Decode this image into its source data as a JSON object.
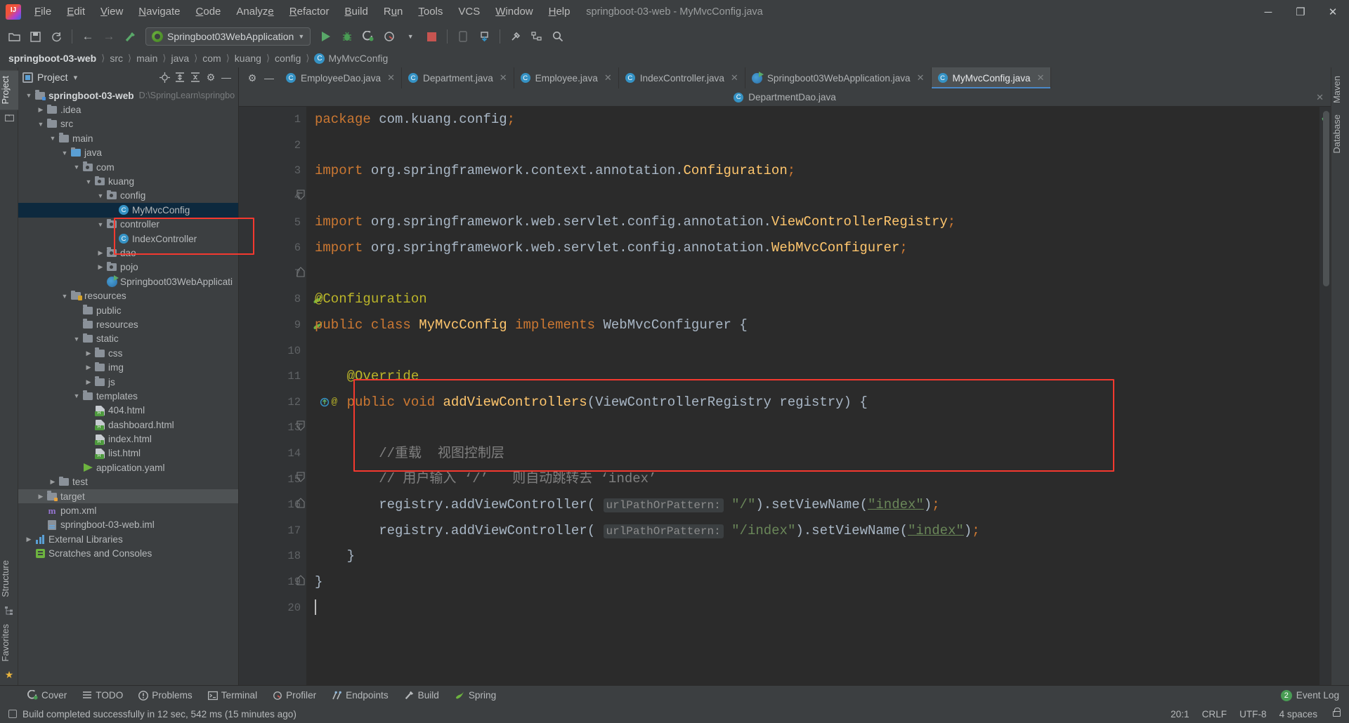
{
  "window": {
    "title": "springboot-03-web - MyMvcConfig.java",
    "minimize": "─",
    "maximize": "❐",
    "close": "✕"
  },
  "menu": {
    "items": [
      "File",
      "Edit",
      "View",
      "Navigate",
      "Code",
      "Analyze",
      "Refactor",
      "Build",
      "Run",
      "Tools",
      "VCS",
      "Window",
      "Help"
    ]
  },
  "toolbar": {
    "open_icon": "open-folder-icon",
    "save_icon": "save-icon",
    "sync_icon": "sync-icon",
    "back_icon": "←",
    "forward_icon": "→",
    "build_icon": "hammer-icon",
    "run_config": "Springboot03WebApplication",
    "run_icon": "run-icon",
    "debug_icon": "debug-icon",
    "coverage_icon": "run-with-coverage-icon",
    "profile_icon": "profile-icon",
    "stop_icon": "stop-icon",
    "device_icon": "device-manager-icon",
    "update_icon": "update-project-icon",
    "settings_icon": "settings-icon",
    "search_icon": "search-everywhere-icon"
  },
  "breadcrumb": {
    "items": [
      "springboot-03-web",
      "src",
      "main",
      "java",
      "com",
      "kuang",
      "config",
      "MyMvcConfig"
    ],
    "last_is_class": true
  },
  "left_rail": {
    "top": [
      "Project"
    ],
    "bottom": [
      "Structure",
      "Favorites"
    ]
  },
  "right_rail": {
    "items": [
      "Maven",
      "Database"
    ]
  },
  "project_panel": {
    "title": "Project",
    "dropdown": "▾",
    "locate_icon": "locate-icon",
    "expand_icon": "expand-all-icon",
    "collapse_icon": "collapse-all-icon",
    "settings_icon": "gear-icon",
    "hide_icon": "hide-icon",
    "tree": [
      {
        "label": "springboot-03-web",
        "path": "D:\\SpringLearn\\springbo",
        "depth": 0,
        "arrow": "down",
        "icon": "module-folder",
        "bold": true
      },
      {
        "label": ".idea",
        "depth": 1,
        "arrow": "right",
        "icon": "folder"
      },
      {
        "label": "src",
        "depth": 1,
        "arrow": "down",
        "icon": "folder"
      },
      {
        "label": "main",
        "depth": 2,
        "arrow": "down",
        "icon": "folder"
      },
      {
        "label": "java",
        "depth": 3,
        "arrow": "down",
        "icon": "source-folder"
      },
      {
        "label": "com",
        "depth": 4,
        "arrow": "down",
        "icon": "package"
      },
      {
        "label": "kuang",
        "depth": 5,
        "arrow": "down",
        "icon": "package"
      },
      {
        "label": "config",
        "depth": 6,
        "arrow": "down",
        "icon": "package"
      },
      {
        "label": "MyMvcConfig",
        "depth": 7,
        "arrow": "none",
        "icon": "class",
        "selected": true
      },
      {
        "label": "controller",
        "depth": 6,
        "arrow": "down",
        "icon": "package"
      },
      {
        "label": "IndexController",
        "depth": 7,
        "arrow": "none",
        "icon": "class"
      },
      {
        "label": "dao",
        "depth": 6,
        "arrow": "right",
        "icon": "package"
      },
      {
        "label": "pojo",
        "depth": 6,
        "arrow": "right",
        "icon": "package"
      },
      {
        "label": "Springboot03WebApplicati",
        "depth": 6,
        "arrow": "none",
        "icon": "spring-run-class"
      },
      {
        "label": "resources",
        "depth": 3,
        "arrow": "down",
        "icon": "resource-folder"
      },
      {
        "label": "public",
        "depth": 4,
        "arrow": "none",
        "icon": "folder"
      },
      {
        "label": "resources",
        "depth": 4,
        "arrow": "none",
        "icon": "folder"
      },
      {
        "label": "static",
        "depth": 4,
        "arrow": "down",
        "icon": "folder"
      },
      {
        "label": "css",
        "depth": 5,
        "arrow": "right",
        "icon": "folder"
      },
      {
        "label": "img",
        "depth": 5,
        "arrow": "right",
        "icon": "folder"
      },
      {
        "label": "js",
        "depth": 5,
        "arrow": "right",
        "icon": "folder"
      },
      {
        "label": "templates",
        "depth": 4,
        "arrow": "down",
        "icon": "folder"
      },
      {
        "label": "404.html",
        "depth": 5,
        "arrow": "none",
        "icon": "html"
      },
      {
        "label": "dashboard.html",
        "depth": 5,
        "arrow": "none",
        "icon": "html"
      },
      {
        "label": "index.html",
        "depth": 5,
        "arrow": "none",
        "icon": "html"
      },
      {
        "label": "list.html",
        "depth": 5,
        "arrow": "none",
        "icon": "html"
      },
      {
        "label": "application.yaml",
        "depth": 4,
        "arrow": "none",
        "icon": "yaml"
      },
      {
        "label": "test",
        "depth": 2,
        "arrow": "right",
        "icon": "folder"
      },
      {
        "label": "target",
        "depth": 1,
        "arrow": "right",
        "icon": "target-folder",
        "hover": true
      },
      {
        "label": "pom.xml",
        "depth": 1,
        "arrow": "none",
        "icon": "maven"
      },
      {
        "label": "springboot-03-web.iml",
        "depth": 1,
        "arrow": "none",
        "icon": "iml"
      },
      {
        "label": "External Libraries",
        "depth": 0,
        "arrow": "right",
        "icon": "libraries"
      },
      {
        "label": "Scratches and Consoles",
        "depth": 0,
        "arrow": "none",
        "icon": "scratches"
      }
    ]
  },
  "editor": {
    "tabs_row1": [
      {
        "label": "EmployeeDao.java",
        "icon": "class",
        "active": false
      },
      {
        "label": "Department.java",
        "icon": "class",
        "active": false
      },
      {
        "label": "Employee.java",
        "icon": "class",
        "active": false
      },
      {
        "label": "IndexController.java",
        "icon": "class",
        "active": false
      },
      {
        "label": "Springboot03WebApplication.java",
        "icon": "spring-run-class",
        "active": false
      },
      {
        "label": "MyMvcConfig.java",
        "icon": "class",
        "active": true
      }
    ],
    "tabs_row2": [
      {
        "label": "DepartmentDao.java",
        "icon": "class",
        "active": true
      }
    ],
    "close_glyph": "✕",
    "lines": [
      {
        "n": 1,
        "html": "<span class=\"k\">package</span> <span class=\"pn\">com.kuang.config</span><span class=\"k\">;</span>"
      },
      {
        "n": 2,
        "html": ""
      },
      {
        "n": 3,
        "html": "<span class=\"k\">import</span> <span class=\"pn\">org.springframework.context.annotation.</span><span class=\"cl\">Configuration</span><span class=\"k\">;</span>",
        "fold": "start"
      },
      {
        "n": 4,
        "html": ""
      },
      {
        "n": 5,
        "html": "<span class=\"k\">import</span> <span class=\"pn\">org.springframework.web.servlet.config.annotation.</span><span class=\"cl\">ViewControllerRegistry</span><span class=\"k\">;</span>"
      },
      {
        "n": 6,
        "html": "<span class=\"k\">import</span> <span class=\"pn\">org.springframework.web.servlet.config.annotation.</span><span class=\"cl\">WebMvcConfigurer</span><span class=\"k\">;</span>",
        "fold": "end"
      },
      {
        "n": 7,
        "html": ""
      },
      {
        "n": 8,
        "html": "<span class=\"an\">@Configuration</span>",
        "gutter": "spring-bean"
      },
      {
        "n": 9,
        "html": "<span class=\"k\">public class </span><span class=\"cl\">MyMvcConfig</span> <span class=\"k\">implements</span> <span class=\"pn\">WebMvcConfigurer</span> {",
        "gutter": "spring-bean"
      },
      {
        "n": 10,
        "html": ""
      },
      {
        "n": 11,
        "html": "    <span class=\"an\">@Override</span>"
      },
      {
        "n": 12,
        "html": "    <span class=\"k\">public void </span><span class=\"cl\">addViewControllers</span>(<span class=\"pn\">ViewControllerRegistry</span> registry) {",
        "gutter": "override",
        "fold": "start"
      },
      {
        "n": 13,
        "html": ""
      },
      {
        "n": 14,
        "html": "        <span class=\"cm\">//重载  视图控制层</span>",
        "fold": "start"
      },
      {
        "n": 15,
        "html": "        <span class=\"cm\">// 用户输入 ‘/’   则自动跳转去 ‘index’</span>",
        "fold": "end2"
      },
      {
        "n": 16,
        "html": "        registry.<span class=\"pn\">addViewController</span>( <span class=\"hint\">urlPathOrPattern:</span> <span class=\"st\">\"/\"</span>).<span class=\"pn\">setViewName</span>(<span class=\"st uline\">\"index\"</span>)<span class=\"k\">;</span>"
      },
      {
        "n": 17,
        "html": "        registry.<span class=\"pn\">addViewController</span>( <span class=\"hint\">urlPathOrPattern:</span> <span class=\"st\">\"/index\"</span>).<span class=\"pn\">setViewName</span>(<span class=\"st uline\">\"index\"</span>)<span class=\"k\">;</span>"
      },
      {
        "n": 18,
        "html": "    }",
        "fold": "end"
      },
      {
        "n": 19,
        "html": "}"
      },
      {
        "n": 20,
        "html": "<span class=\"caret\"></span>"
      }
    ],
    "inspection_ok": "✔"
  },
  "bottom_bar": {
    "items": [
      {
        "label": "Cover",
        "icon": "coverage-icon"
      },
      {
        "label": "TODO",
        "icon": "todo-icon"
      },
      {
        "label": "Problems",
        "icon": "problems-icon"
      },
      {
        "label": "Terminal",
        "icon": "terminal-icon"
      },
      {
        "label": "Profiler",
        "icon": "profiler-icon"
      },
      {
        "label": "Endpoints",
        "icon": "endpoints-icon"
      },
      {
        "label": "Build",
        "icon": "build-icon"
      },
      {
        "label": "Spring",
        "icon": "spring-icon"
      }
    ],
    "event_log": "Event Log",
    "event_count": "2"
  },
  "status_bar": {
    "message": "Build completed successfully in 12 sec, 542 ms (15 minutes ago)",
    "caret_position": "20:1",
    "line_separator": "CRLF",
    "encoding": "UTF-8",
    "indent": "4 spaces",
    "lock_icon": "unlocked-icon",
    "message_icon": "message-icon"
  },
  "colors": {
    "accent_blue": "#3592c4",
    "highlight_red": "#f4392f",
    "selection_blue": "#0d293e",
    "editor_bg": "#2b2b2b",
    "panel_bg": "#3c3f41"
  }
}
